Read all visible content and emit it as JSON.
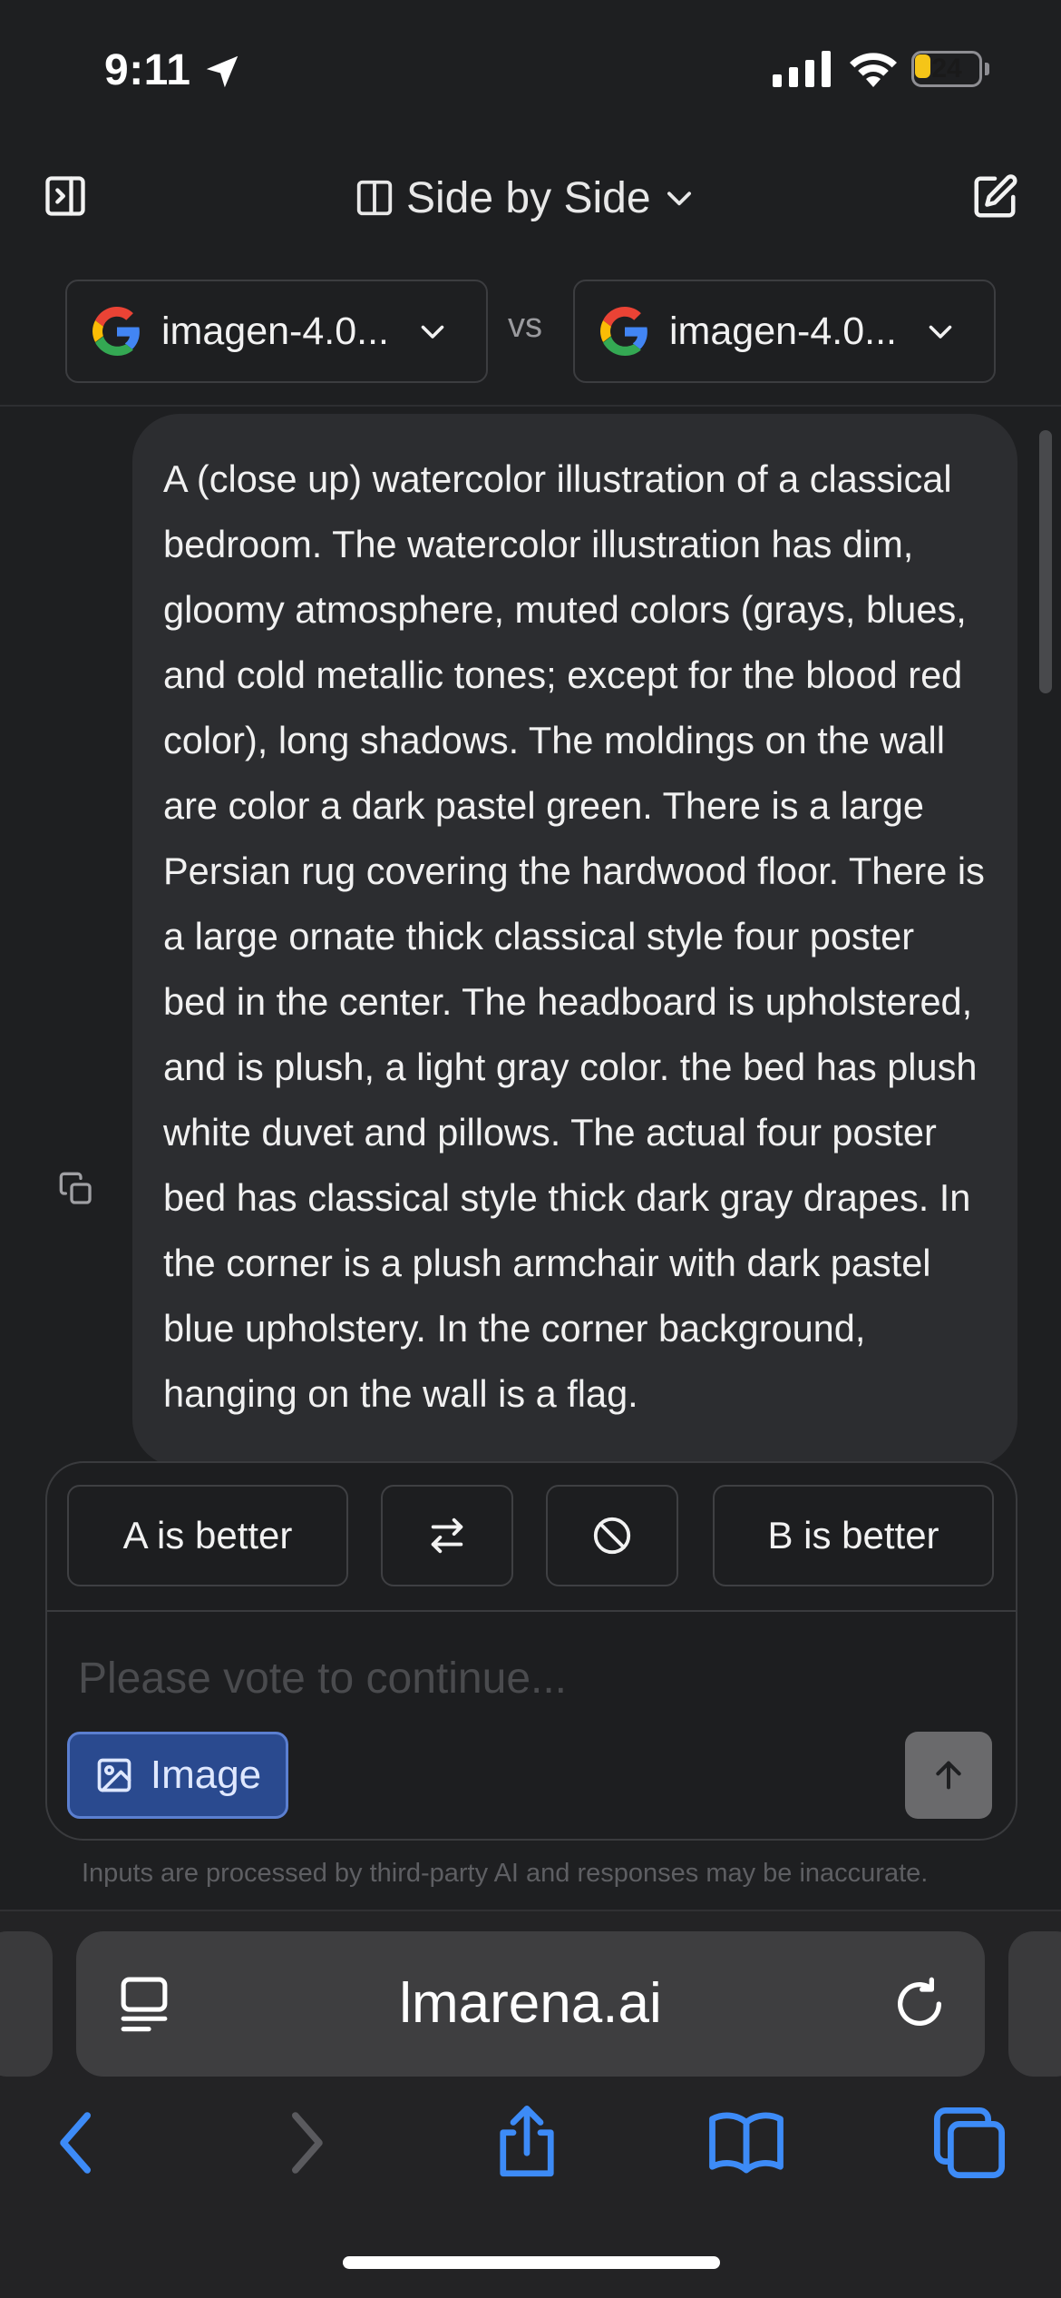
{
  "status_bar": {
    "time": "9:11",
    "battery": "24",
    "battery_fill": 0.24
  },
  "header": {
    "mode_title": "Side by Side",
    "icons": [
      "sidebar-toggle-icon",
      "split-view-icon",
      "chevron-down-icon",
      "edit-icon"
    ]
  },
  "models": {
    "a_name": "imagen-4.0...",
    "b_name": "imagen-4.0...",
    "vs_label": "vs"
  },
  "prompt": {
    "text": "A (close up) watercolor illustration of a classical bedroom. The watercolor illustration has dim, gloomy atmosphere, muted colors (grays, blues, and cold metallic tones; except for the blood red color), long shadows. The moldings on the wall are color a dark pastel green. There is a large Persian rug covering the hardwood floor. There is a large ornate thick classical style four poster bed in the center. The headboard is upholstered, and is plush, a light gray color. the bed has plush white duvet and pillows. The actual four poster bed has classical style thick dark gray drapes. In the corner is a plush armchair with dark pastel blue upholstery. In the corner background, hanging on the wall is a flag."
  },
  "vote": {
    "a_better": "A is better",
    "b_better": "B is better",
    "input_placeholder": "Please vote to continue...",
    "image_label": "Image",
    "disclaimer": "Inputs are processed by third-party AI and responses may be inaccurate."
  },
  "browser": {
    "url": "lmarena.ai"
  },
  "colors": {
    "background": "#1e1f21",
    "bubble": "#2c2d30",
    "image_button": "#2a4a8f",
    "safari_accent": "#3d8bf7",
    "battery": "#f5c518"
  }
}
